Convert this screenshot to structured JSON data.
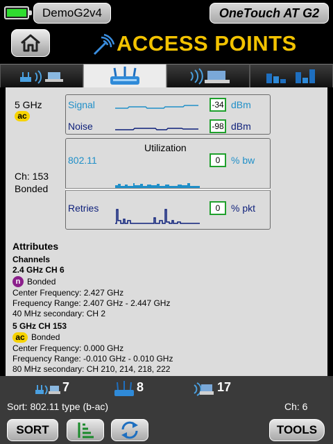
{
  "status": {
    "device_name": "DemoG2v4",
    "product_name": "OneTouch AT G2"
  },
  "header": {
    "title": "ACCESS POINTS",
    "home_icon": "home-icon"
  },
  "tabs": [
    {
      "icon": "networks-tab-icon",
      "active": false
    },
    {
      "icon": "access-point-tab-icon",
      "active": true
    },
    {
      "icon": "clients-tab-icon",
      "active": false
    },
    {
      "icon": "channels-tab-icon",
      "active": false
    }
  ],
  "detail": {
    "band": "5 GHz",
    "band_badge": "ac",
    "channel_line1": "Ch: 153",
    "channel_line2": "Bonded",
    "signal": {
      "label": "Signal",
      "value": "-34",
      "unit": "dBm"
    },
    "noise": {
      "label": "Noise",
      "value": "-98",
      "unit": "dBm"
    },
    "utilization": {
      "title": "Utilization",
      "label": "802.11",
      "value": "0",
      "unit": "% bw"
    },
    "retries": {
      "label": "Retries",
      "value": "0",
      "unit": "% pkt"
    }
  },
  "attributes": {
    "heading": "Attributes",
    "channels_heading": "Channels",
    "ch1": {
      "title": "2.4 GHz CH 6",
      "badge": "n",
      "bonded": "Bonded",
      "center": "Center Frequency: 2.427 GHz",
      "range": "Frequency Range: 2.407 GHz - 2.447 GHz",
      "secondary": "40 MHz secondary: CH 2"
    },
    "ch2": {
      "title": "5 GHz CH 153",
      "badge": "ac",
      "bonded": "Bonded",
      "center": "Center Frequency: 0.000 GHz",
      "range": "Frequency Range: -0.010 GHz - 0.010 GHz",
      "secondary": "80 MHz secondary: CH 210, 214, 218, 222"
    }
  },
  "footer": {
    "networks_count": "7",
    "ap_count": "8",
    "clients_count": "17",
    "sort_text": "Sort: 802.11 type (b-ac)",
    "channel_text": "Ch:  6",
    "sort_button": "SORT",
    "tools_button": "TOOLS"
  },
  "colors": {
    "title_yellow": "#f2c200",
    "signal_blue": "#1f8fc8",
    "noise_navy": "#0d1f7a",
    "value_border_green": "#1fa02c",
    "ac_yellow": "#f7d300",
    "n_purple": "#8b1f8b",
    "battery_green": "#2fdc2f"
  }
}
